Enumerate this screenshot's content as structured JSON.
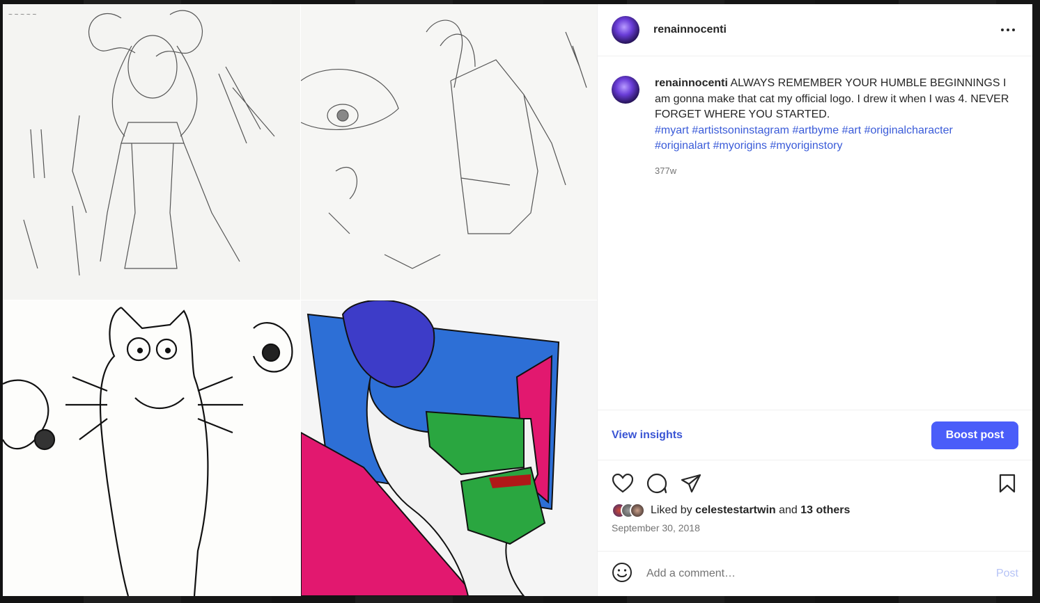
{
  "post": {
    "username": "renainnocenti",
    "caption": {
      "username": "renainnocenti",
      "text": "ALWAYS REMEMBER YOUR HUMBLE BEGINNINGS I am gonna make that cat my official logo. I drew it when I was 4. NEVER FORGET WHERE YOU STARTED.",
      "hashtags": [
        "#myart",
        "#artistsoninstagram",
        "#artbyme",
        "#art",
        "#originalcharacter",
        "#originalart",
        "#myorigins",
        "#myoriginstory"
      ],
      "age": "377w"
    },
    "insights_label": "View insights",
    "boost_label": "Boost post",
    "likes": {
      "prefix": "Liked by",
      "user": "celestestartwin",
      "conjunction": "and",
      "others": "13 others"
    },
    "date": "September 30, 2018",
    "comment_placeholder": "Add a comment…",
    "post_button": "Post"
  },
  "colors": {
    "accent": "#4a5df9",
    "link": "#3a55d4",
    "hashtag": "#3a5bd8",
    "post_disabled": "#b6c3f6"
  },
  "icons": [
    "more-icon",
    "heart-icon",
    "comment-icon",
    "share-icon",
    "bookmark-icon",
    "emoji-icon"
  ]
}
